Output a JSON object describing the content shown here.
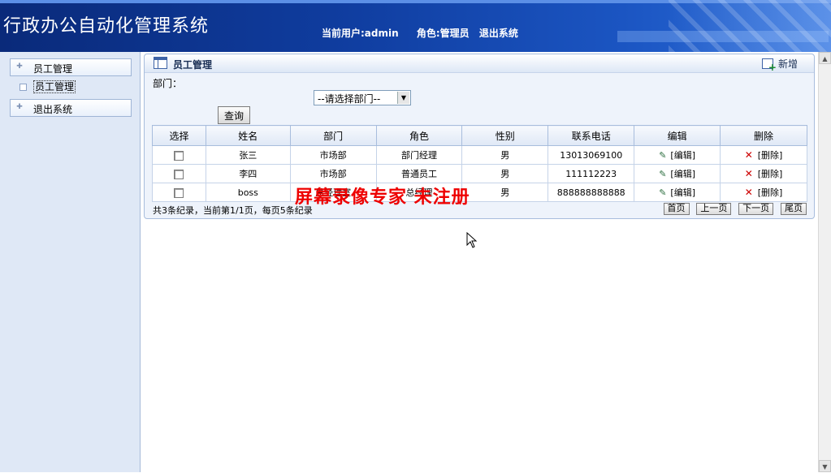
{
  "header": {
    "app_title": "行政办公自动化管理系统",
    "current_user": "当前用户:admin",
    "role": "角色:管理员",
    "logout": "退出系统"
  },
  "sidebar": {
    "items": [
      {
        "label": "员工管理"
      },
      {
        "label": "员工管理"
      },
      {
        "label": "退出系统"
      }
    ]
  },
  "panel": {
    "title": "员工管理",
    "add_label": "新增",
    "dept_label": "部门：",
    "dept_select_value": "--请选择部门--",
    "query_button": "查询"
  },
  "table": {
    "headers": [
      "选择",
      "姓名",
      "部门",
      "角色",
      "性别",
      "联系电话",
      "编辑",
      "删除"
    ],
    "rows": [
      {
        "name": "张三",
        "dept": "市场部",
        "role": "部门经理",
        "gender": "男",
        "phone": "13013069100",
        "edit": "[编辑]",
        "delete": "[删除]"
      },
      {
        "name": "李四",
        "dept": "市场部",
        "role": "普通员工",
        "gender": "男",
        "phone": "111112223",
        "edit": "[编辑]",
        "delete": "[删除]"
      },
      {
        "name": "boss",
        "dept": "总经理室",
        "role": "总经理",
        "gender": "男",
        "phone": "888888888888",
        "edit": "[编辑]",
        "delete": "[删除]"
      }
    ]
  },
  "footer": {
    "summary": "共3条纪录，当前第1/1页，每页5条纪录",
    "first": "首页",
    "prev": "上一页",
    "next": "下一页",
    "last": "尾页"
  },
  "watermark": "屏幕录像专家  未注册",
  "colors": {
    "header_bg": "#0f3c9e",
    "watermark": "#ee0000",
    "panel_bg": "#eef3fb"
  }
}
